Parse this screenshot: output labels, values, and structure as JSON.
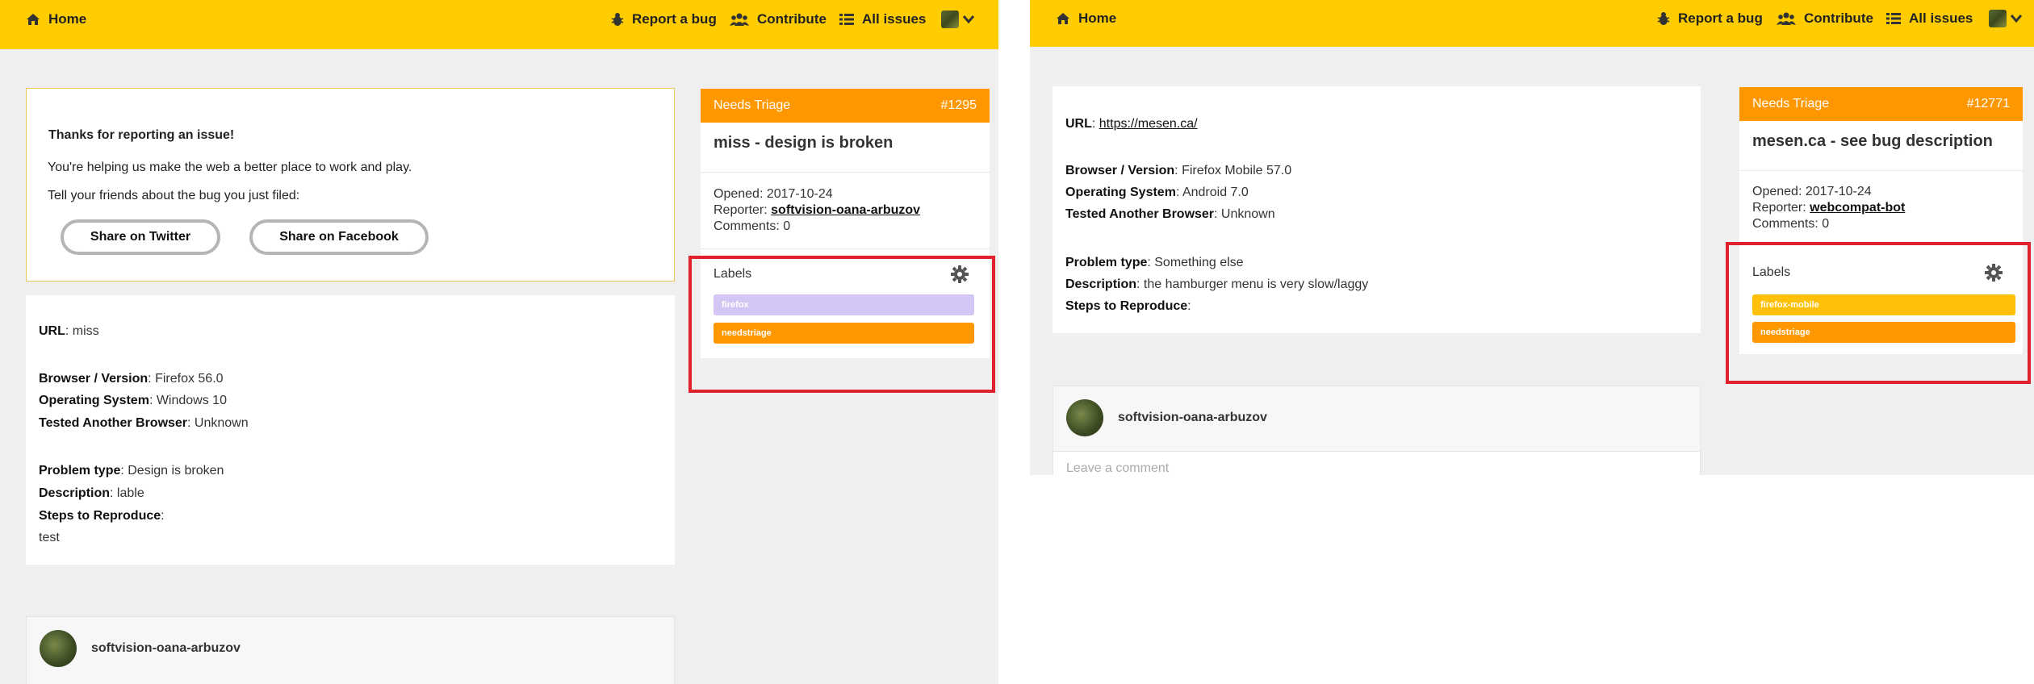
{
  "nav": {
    "home": "Home",
    "report_bug": "Report a bug",
    "contribute": "Contribute",
    "all_issues": "All issues"
  },
  "left": {
    "thanks": {
      "title": "Thanks for reporting an issue!",
      "line1": "You're helping us make the web a better place to work and play.",
      "line2": "Tell your friends about the bug you just filed:",
      "twitter_button": "Share on Twitter",
      "facebook_button": "Share on Facebook"
    },
    "details": {
      "url_label": "URL",
      "url_value": ": miss",
      "browser_label": "Browser / Version",
      "browser_value": ": Firefox 56.0",
      "os_label": "Operating System",
      "os_value": ": Windows 10",
      "tested_label": "Tested Another Browser",
      "tested_value": ": Unknown",
      "problem_label": "Problem type",
      "problem_value": ": Design is broken",
      "description_label": "Description",
      "description_value": ": lable",
      "steps_label": "Steps to Reproduce",
      "steps_value": ":",
      "steps_text": "test"
    },
    "issue": {
      "status": "Needs Triage",
      "number": "#1295",
      "title": "miss - design is broken",
      "opened": "Opened: 2017-10-24",
      "reporter_prefix": "Reporter: ",
      "reporter": "softvision-oana-arbuzov",
      "comments": "Comments: 0"
    },
    "labels": {
      "title": "Labels",
      "items": [
        {
          "text": "firefox",
          "color": "#d3c6f5"
        },
        {
          "text": "needstriage",
          "color": "#ff9800"
        }
      ]
    },
    "comment_user": "softvision-oana-arbuzov"
  },
  "right": {
    "details": {
      "url_label": "URL",
      "url_sep": ": ",
      "url_link": "https://mesen.ca/",
      "browser_label": "Browser / Version",
      "browser_value": ": Firefox Mobile 57.0",
      "os_label": "Operating System",
      "os_value": ": Android 7.0",
      "tested_label": "Tested Another Browser",
      "tested_value": ": Unknown",
      "problem_label": "Problem type",
      "problem_value": ": Something else",
      "description_label": "Description",
      "description_value": ": the hamburger menu is very slow/laggy",
      "steps_label": "Steps to Reproduce",
      "steps_value": ":"
    },
    "issue": {
      "status": "Needs Triage",
      "number": "#12771",
      "title": "mesen.ca - see bug description",
      "opened": "Opened: 2017-10-24",
      "reporter_prefix": "Reporter: ",
      "reporter": "webcompat-bot",
      "comments": "Comments: 0"
    },
    "labels": {
      "title": "Labels",
      "items": [
        {
          "text": "firefox-mobile",
          "color": "#ffc107"
        },
        {
          "text": "needstriage",
          "color": "#ff9800"
        }
      ]
    },
    "comment_user": "softvision-oana-arbuzov",
    "comment_placeholder": "Leave a comment"
  },
  "colors": {
    "navbar": "#ffcc00",
    "triage_header": "#ff9800",
    "highlight_box": "#e0202a",
    "background": "#efefef"
  }
}
